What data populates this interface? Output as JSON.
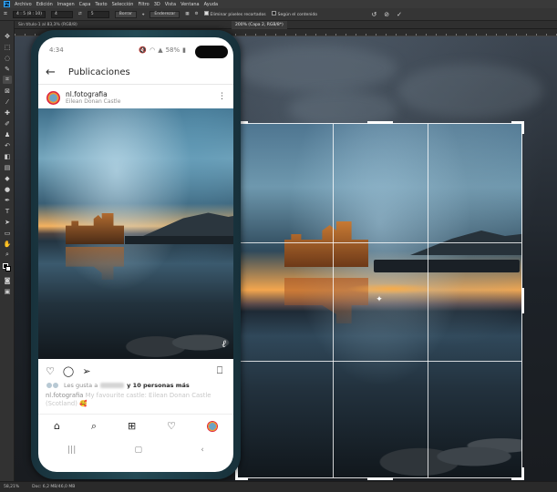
{
  "menubar": {
    "logo": "Ps",
    "items": [
      "Archivo",
      "Edición",
      "Imagen",
      "Capa",
      "Texto",
      "Selección",
      "Filtro",
      "3D",
      "Vista",
      "Ventana",
      "Ayuda"
    ]
  },
  "options": {
    "ratio": "4 : 5 (8 : 10)",
    "width": "4",
    "height": "5",
    "clear_button": "Borrar",
    "straighten_label": "Enderezar",
    "delete_pixels_label": "Eliminar píxeles recortados",
    "content_aware_label": "Según el contenido",
    "reset_icon": "↺",
    "cancel_icon": "⊘",
    "commit_icon": "✓"
  },
  "document": {
    "tab_left": "Sin título-1 al 83,3% (RGB/8)",
    "tab_active": "200% (Capa 2, RGB/8*)"
  },
  "statusbar": {
    "zoom": "58,21%",
    "doc": "Doc: 6,2 MB/46,0 MB"
  },
  "phone": {
    "time": "4:34",
    "battery": "58%",
    "header_title": "Publicaciones",
    "username": "nl.fotografia",
    "location": "Eilean Donan Castle",
    "likes_prefix": "Les gusta a",
    "likes_suffix": "y 10 personas más",
    "caption_user": "nl.fotografia",
    "caption_text": "My favourite castle: Eilean Donan Castle (Scotland) 🥰",
    "signature": "ℓ"
  },
  "colors": {
    "accent": "#31a8ff",
    "panel": "#323232"
  }
}
